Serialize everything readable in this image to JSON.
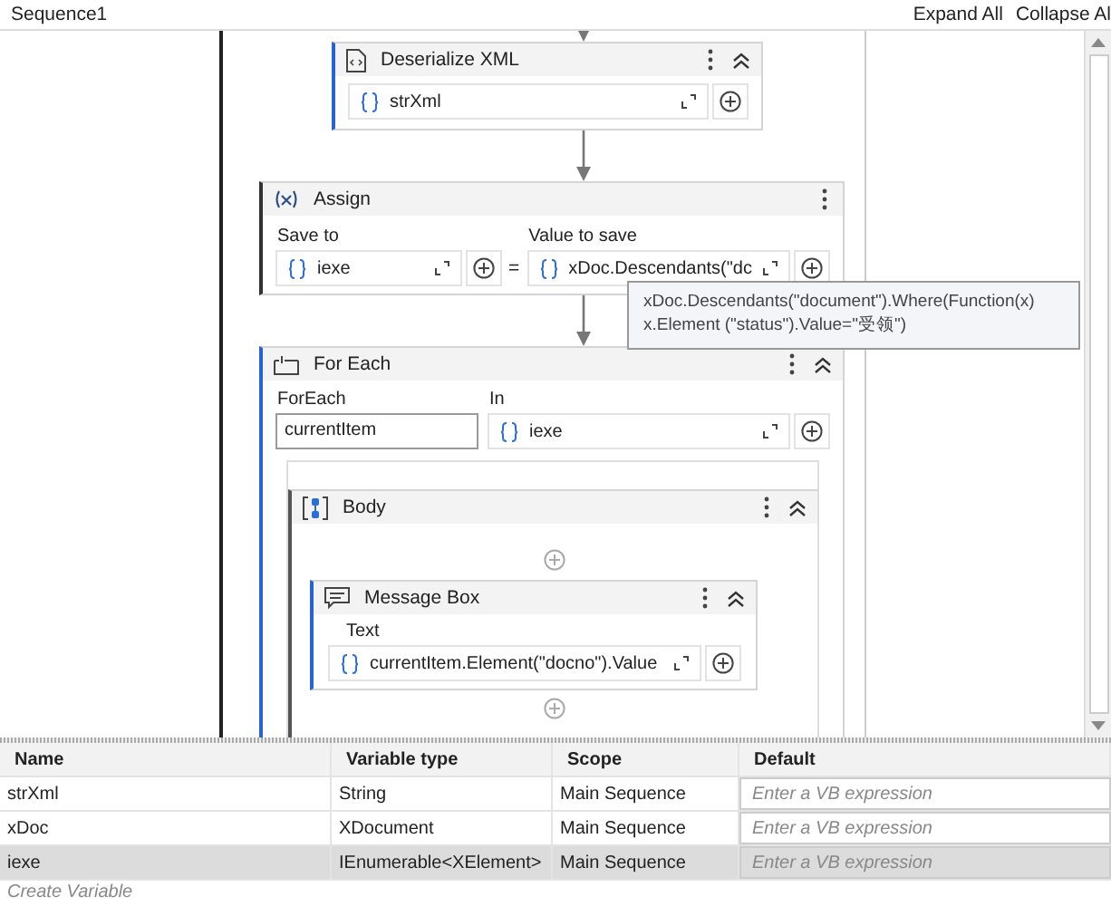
{
  "document_title": "Sequence1",
  "header_actions": [
    "Expand All",
    "Collapse Al"
  ],
  "deserialize_xml": {
    "title": "Deserialize XML",
    "value": "strXml"
  },
  "assign": {
    "title": "Assign",
    "save_to_label": "Save to",
    "save_to_value": "iexe",
    "equals": "=",
    "value_label": "Value to save",
    "value_value": "xDoc.Descendants(\"dc"
  },
  "tooltip": {
    "text": "xDoc.Descendants(\"document\").Where(Function(x) x.Element (\"status\").Value=\"受领\")"
  },
  "for_each": {
    "title": "For Each",
    "item_label": "ForEach",
    "item_value": "currentItem",
    "in_label": "In",
    "in_value": "iexe",
    "body": {
      "title": "Body",
      "message_box": {
        "title": "Message Box",
        "text_label": "Text",
        "text_value": "currentItem.Element(\"docno\").Value"
      }
    }
  },
  "variables": {
    "columns": [
      "Name",
      "Variable type",
      "Scope",
      "Default"
    ],
    "rows": [
      {
        "name": "strXml",
        "type": "String",
        "scope": "Main Sequence",
        "default_placeholder": "Enter a VB expression",
        "selected": false
      },
      {
        "name": "xDoc",
        "type": "XDocument",
        "scope": "Main Sequence",
        "default_placeholder": "Enter a VB expression",
        "selected": false
      },
      {
        "name": "iexe",
        "type": "IEnumerable<XElement>",
        "scope": "Main Sequence",
        "default_placeholder": "Enter a VB expression",
        "selected": true
      }
    ],
    "create_placeholder": "Create Variable"
  }
}
